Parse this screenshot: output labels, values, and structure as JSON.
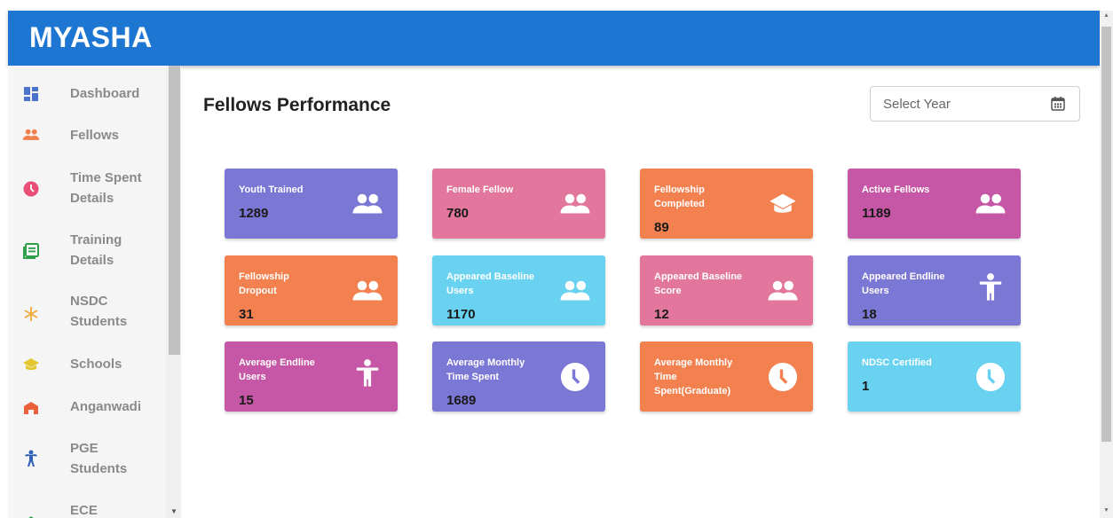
{
  "app": {
    "brand": "MYASHA",
    "brand_color": "#1c76d2"
  },
  "sidebar": {
    "items": [
      {
        "name": "dashboard",
        "label": "Dashboard",
        "icon": "dashboard-icon",
        "color": "#4a73c9"
      },
      {
        "name": "fellows",
        "label": "Fellows",
        "icon": "people-icon",
        "color": "#f38150"
      },
      {
        "name": "time-spent",
        "label": "Time Spent Details",
        "icon": "clock-icon",
        "color": "#e94f74"
      },
      {
        "name": "training",
        "label": "Training Details",
        "icon": "list-icon",
        "color": "#2e9e4a"
      },
      {
        "name": "nsdc",
        "label": "NSDC Students",
        "icon": "snowflake-icon",
        "color": "#f0a93a"
      },
      {
        "name": "schools",
        "label": "Schools",
        "icon": "graduation-cap-icon",
        "color": "#e5c62e"
      },
      {
        "name": "anganwadi",
        "label": "Anganwadi",
        "icon": "building-icon",
        "color": "#e8613a"
      },
      {
        "name": "pge",
        "label": "PGE Students",
        "icon": "person-icon",
        "color": "#3060b8"
      },
      {
        "name": "ece",
        "label": "ECE",
        "icon": "person-icon",
        "color": "#2e9e4a"
      }
    ]
  },
  "main": {
    "title": "Fellows Performance",
    "year_select": {
      "placeholder": "Select Year",
      "icon": "calendar-icon"
    },
    "cards": [
      {
        "label": "Youth Trained",
        "value": "1289",
        "icon": "people-icon",
        "color": "#7b77d5"
      },
      {
        "label": "Female Fellow",
        "value": "780",
        "icon": "people-icon",
        "color": "#e2769c"
      },
      {
        "label": "Fellowship Completed",
        "value": "89",
        "icon": "graduation-cap-icon",
        "color": "#f38150"
      },
      {
        "label": "Active Fellows",
        "value": "1189",
        "icon": "people-icon",
        "color": "#c657a6"
      },
      {
        "label": "Fellowship Dropout",
        "value": "31",
        "icon": "people-icon",
        "color": "#f38150"
      },
      {
        "label": "Appeared Baseline Users",
        "value": "1170",
        "icon": "people-icon",
        "color": "#69d2f0"
      },
      {
        "label": "Appeared Baseline Score",
        "value": "12",
        "icon": "people-icon",
        "color": "#e2769c"
      },
      {
        "label": "Appeared Endline Users",
        "value": "18",
        "icon": "person-icon",
        "color": "#7b77d5"
      },
      {
        "label": "Average Endline Users",
        "value": "15",
        "icon": "person-icon",
        "color": "#c657a6"
      },
      {
        "label": "Average Monthly Time Spent",
        "value": "1689",
        "icon": "clock-icon",
        "color": "#7b77d5"
      },
      {
        "label": "Average Monthly Time Spent(Graduate)",
        "value": "",
        "icon": "clock-icon",
        "color": "#f38150"
      },
      {
        "label": "NDSC Certified",
        "value": "1",
        "icon": "clock-icon",
        "color": "#69d2f0"
      }
    ]
  }
}
